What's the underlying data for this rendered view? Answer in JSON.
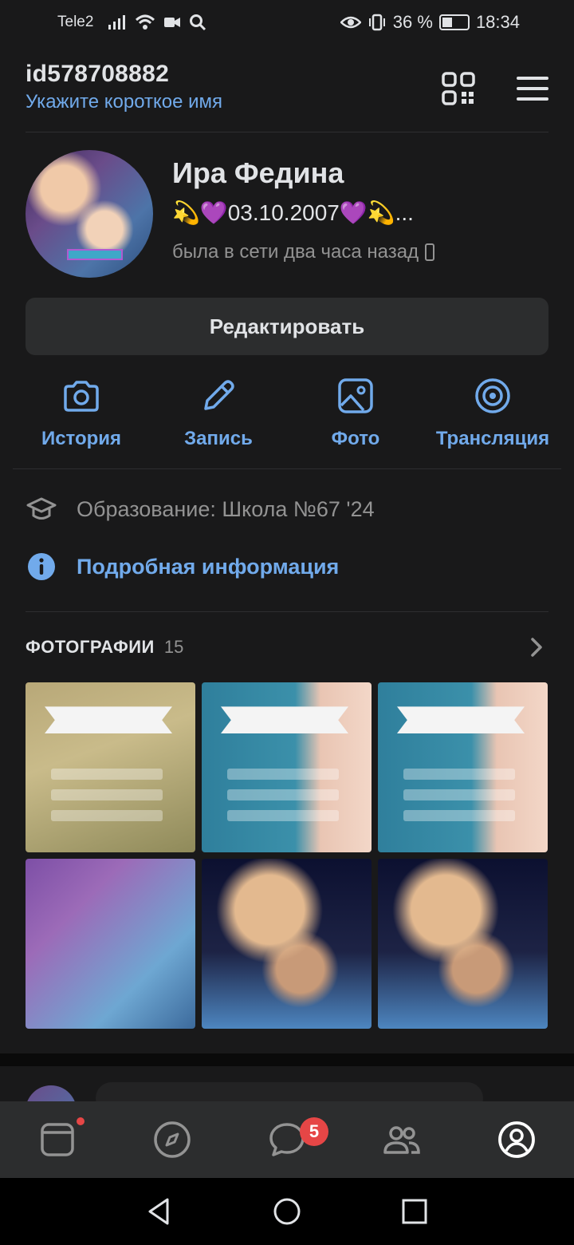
{
  "status_bar": {
    "carrier": "Tele2",
    "battery_percent": "36 %",
    "time": "18:34"
  },
  "header": {
    "user_id": "id578708882",
    "short_name_prompt": "Укажите короткое имя",
    "icons": [
      "qr-code-icon",
      "menu-icon"
    ]
  },
  "profile": {
    "name": "Ира Федина",
    "status": "💫💜03.10.2007💜💫...",
    "online": "была в сети два часа назад"
  },
  "edit_button": "Редактировать",
  "actions": [
    {
      "label": "История",
      "icon": "camera-icon"
    },
    {
      "label": "Запись",
      "icon": "pencil-icon"
    },
    {
      "label": "Фото",
      "icon": "image-icon"
    },
    {
      "label": "Трансляция",
      "icon": "broadcast-icon"
    }
  ],
  "info": {
    "education": "Образование: Школа №67 '24",
    "more": "Подробная информация"
  },
  "photos": {
    "title": "ФОТОГРАФИИ",
    "count": "15"
  },
  "tabbar": {
    "messages_badge": "5",
    "active": "profile"
  },
  "colors": {
    "background": "#19191a",
    "accent": "#71aaeb",
    "secondary_text": "#939393",
    "badge": "#e64646"
  }
}
